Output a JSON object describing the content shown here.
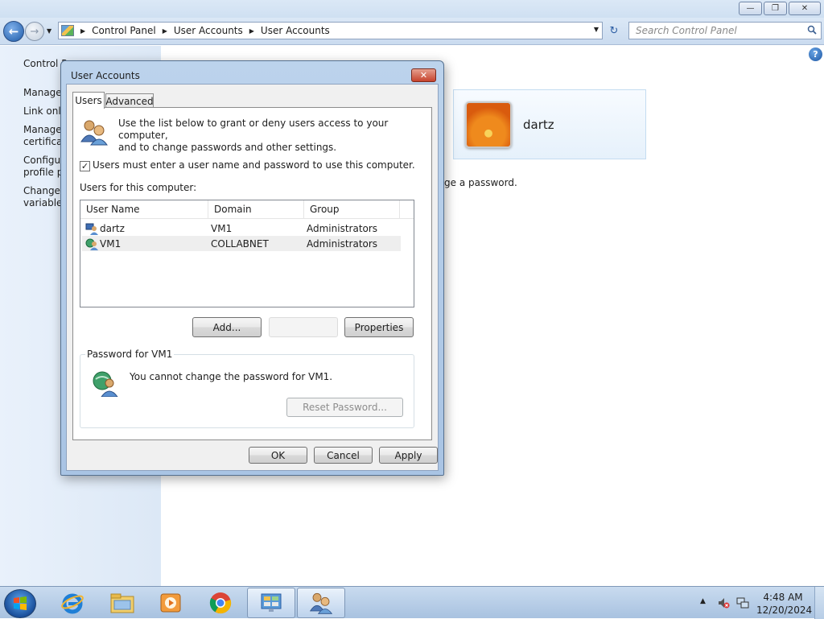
{
  "window": {
    "caption_buttons": [
      "minimize-icon",
      "restore-icon",
      "close-icon"
    ],
    "breadcrumb": [
      "Control Panel",
      "User Accounts",
      "User Accounts"
    ],
    "search_placeholder": "Search Control Panel"
  },
  "sidebar": {
    "items": [
      {
        "line1": "Control Pa",
        "line2": ""
      },
      {
        "line1": "Manage",
        "line2": ""
      },
      {
        "line1": "Link onli",
        "line2": ""
      },
      {
        "line1": "Manage",
        "line2": "certificat"
      },
      {
        "line1": "Configu",
        "line2": "profile pr"
      },
      {
        "line1": "Change",
        "line2": "variables"
      }
    ]
  },
  "main": {
    "user_tile_name": "dartz",
    "partial_text": "ge a password."
  },
  "dialog": {
    "title": "User Accounts",
    "tabs": [
      "Users",
      "Advanced"
    ],
    "intro_line1": "Use the list below to grant or deny users access to your computer,",
    "intro_line2": "and to change passwords and other settings.",
    "checkbox_label": "Users must enter a user name and password to use this computer.",
    "checkbox_checked": true,
    "users_label": "Users for this computer:",
    "columns": [
      "User Name",
      "Domain",
      "Group"
    ],
    "rows": [
      {
        "name": "dartz",
        "domain": "VM1",
        "group": "Administrators"
      },
      {
        "name": "VM1",
        "domain": "COLLABNET",
        "group": "Administrators"
      }
    ],
    "selected_row": 1,
    "add_button": "Add...",
    "properties_button": "Properties",
    "password_group_title": "Password for VM1",
    "password_message": "You cannot change the password for VM1.",
    "reset_button": "Reset Password...",
    "ok_button": "OK",
    "cancel_button": "Cancel",
    "apply_button": "Apply"
  },
  "taskbar": {
    "items": [
      "internet-explorer-icon",
      "file-explorer-icon",
      "media-player-icon",
      "chrome-icon",
      "control-panel-icon",
      "user-accounts-icon"
    ],
    "time": "4:48 AM",
    "date": "12/20/2024"
  }
}
